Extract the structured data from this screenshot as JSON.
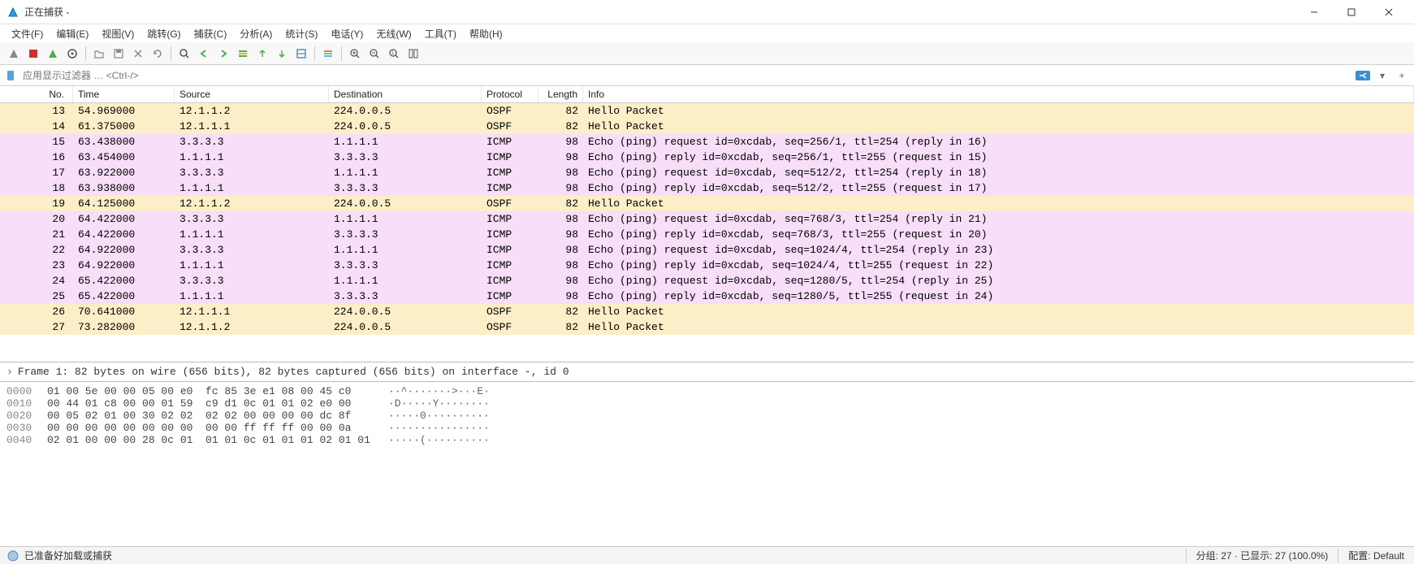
{
  "title": "正在捕获 -",
  "menu": [
    "文件(F)",
    "编辑(E)",
    "视图(V)",
    "跳转(G)",
    "捕获(C)",
    "分析(A)",
    "统计(S)",
    "电话(Y)",
    "无线(W)",
    "工具(T)",
    "帮助(H)"
  ],
  "filter_placeholder": "应用显示过滤器 … <Ctrl-/>",
  "columns": [
    "No.",
    "Time",
    "Source",
    "Destination",
    "Protocol",
    "Length",
    "Info"
  ],
  "packets": [
    {
      "no": "13",
      "time": "54.969000",
      "src": "12.1.1.2",
      "dst": "224.0.0.5",
      "proto": "OSPF",
      "len": "82",
      "info": "Hello Packet",
      "cls": "ospf"
    },
    {
      "no": "14",
      "time": "61.375000",
      "src": "12.1.1.1",
      "dst": "224.0.0.5",
      "proto": "OSPF",
      "len": "82",
      "info": "Hello Packet",
      "cls": "ospf"
    },
    {
      "no": "15",
      "time": "63.438000",
      "src": "3.3.3.3",
      "dst": "1.1.1.1",
      "proto": "ICMP",
      "len": "98",
      "info": "Echo (ping) request  id=0xcdab, seq=256/1, ttl=254 (reply in 16)",
      "cls": "icmp"
    },
    {
      "no": "16",
      "time": "63.454000",
      "src": "1.1.1.1",
      "dst": "3.3.3.3",
      "proto": "ICMP",
      "len": "98",
      "info": "Echo (ping) reply    id=0xcdab, seq=256/1, ttl=255 (request in 15)",
      "cls": "icmp"
    },
    {
      "no": "17",
      "time": "63.922000",
      "src": "3.3.3.3",
      "dst": "1.1.1.1",
      "proto": "ICMP",
      "len": "98",
      "info": "Echo (ping) request  id=0xcdab, seq=512/2, ttl=254 (reply in 18)",
      "cls": "icmp"
    },
    {
      "no": "18",
      "time": "63.938000",
      "src": "1.1.1.1",
      "dst": "3.3.3.3",
      "proto": "ICMP",
      "len": "98",
      "info": "Echo (ping) reply    id=0xcdab, seq=512/2, ttl=255 (request in 17)",
      "cls": "icmp"
    },
    {
      "no": "19",
      "time": "64.125000",
      "src": "12.1.1.2",
      "dst": "224.0.0.5",
      "proto": "OSPF",
      "len": "82",
      "info": "Hello Packet",
      "cls": "ospf"
    },
    {
      "no": "20",
      "time": "64.422000",
      "src": "3.3.3.3",
      "dst": "1.1.1.1",
      "proto": "ICMP",
      "len": "98",
      "info": "Echo (ping) request  id=0xcdab, seq=768/3, ttl=254 (reply in 21)",
      "cls": "icmp"
    },
    {
      "no": "21",
      "time": "64.422000",
      "src": "1.1.1.1",
      "dst": "3.3.3.3",
      "proto": "ICMP",
      "len": "98",
      "info": "Echo (ping) reply    id=0xcdab, seq=768/3, ttl=255 (request in 20)",
      "cls": "icmp"
    },
    {
      "no": "22",
      "time": "64.922000",
      "src": "3.3.3.3",
      "dst": "1.1.1.1",
      "proto": "ICMP",
      "len": "98",
      "info": "Echo (ping) request  id=0xcdab, seq=1024/4, ttl=254 (reply in 23)",
      "cls": "icmp"
    },
    {
      "no": "23",
      "time": "64.922000",
      "src": "1.1.1.1",
      "dst": "3.3.3.3",
      "proto": "ICMP",
      "len": "98",
      "info": "Echo (ping) reply    id=0xcdab, seq=1024/4, ttl=255 (request in 22)",
      "cls": "icmp"
    },
    {
      "no": "24",
      "time": "65.422000",
      "src": "3.3.3.3",
      "dst": "1.1.1.1",
      "proto": "ICMP",
      "len": "98",
      "info": "Echo (ping) request  id=0xcdab, seq=1280/5, ttl=254 (reply in 25)",
      "cls": "icmp"
    },
    {
      "no": "25",
      "time": "65.422000",
      "src": "1.1.1.1",
      "dst": "3.3.3.3",
      "proto": "ICMP",
      "len": "98",
      "info": "Echo (ping) reply    id=0xcdab, seq=1280/5, ttl=255 (request in 24)",
      "cls": "icmp"
    },
    {
      "no": "26",
      "time": "70.641000",
      "src": "12.1.1.1",
      "dst": "224.0.0.5",
      "proto": "OSPF",
      "len": "82",
      "info": "Hello Packet",
      "cls": "ospf"
    },
    {
      "no": "27",
      "time": "73.282000",
      "src": "12.1.1.2",
      "dst": "224.0.0.5",
      "proto": "OSPF",
      "len": "82",
      "info": "Hello Packet",
      "cls": "ospf"
    }
  ],
  "frame_detail": "Frame 1: 82 bytes on wire (656 bits), 82 bytes captured (656 bits) on interface -, id 0",
  "hex": [
    {
      "off": "0000",
      "b": "01 00 5e 00 00 05 00 e0  fc 85 3e e1 08 00 45 c0",
      "a": "··^·······>···E·"
    },
    {
      "off": "0010",
      "b": "00 44 01 c8 00 00 01 59  c9 d1 0c 01 01 02 e0 00",
      "a": "·D·····Y········"
    },
    {
      "off": "0020",
      "b": "00 05 02 01 00 30 02 02  02 02 00 00 00 00 dc 8f",
      "a": "·····0··········"
    },
    {
      "off": "0030",
      "b": "00 00 00 00 00 00 00 00  00 00 ff ff ff 00 00 0a",
      "a": "················"
    },
    {
      "off": "0040",
      "b": "02 01 00 00 00 28 0c 01  01 01 0c 01 01 01 02 01 01",
      "a": "·····(··········"
    }
  ],
  "status": {
    "ready": "已准备好加载或捕获",
    "packets": "分组: 27 · 已显示: 27 (100.0%)",
    "profile": "配置: Default"
  },
  "toolbar_icons": [
    "start-capture",
    "stop-capture",
    "restart-capture",
    "capture-options",
    "",
    "open-file",
    "save-file",
    "close-file",
    "reload",
    "",
    "find",
    "go-back",
    "go-forward",
    "go-to-packet",
    "go-first",
    "go-last",
    "auto-scroll",
    "",
    "colorize",
    "",
    "zoom-in",
    "zoom-out",
    "zoom-reset",
    "resize-columns"
  ],
  "colors": {
    "ospf": "#fceec7",
    "icmp": "#f8def8",
    "accent": "#2b7bb9"
  }
}
